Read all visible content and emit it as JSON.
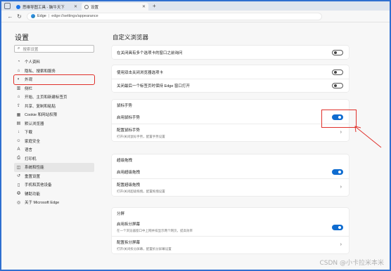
{
  "tabs": [
    {
      "title": "思维导图工具 - 脑牛天下",
      "favicon_color": "#1a73e8"
    },
    {
      "title": "设置",
      "favicon_color": "#666666",
      "active": true
    }
  ],
  "address_bar": {
    "browser": "Edge",
    "url": "edge://settings/appearance"
  },
  "sidebar": {
    "title": "设置",
    "search_placeholder": "搜索设置",
    "items": [
      {
        "label": "个人资料",
        "icon": "person-icon",
        "glyph": "◔"
      },
      {
        "label": "隐私、搜索和服务",
        "icon": "lock-icon",
        "glyph": "⌂"
      },
      {
        "label": "外观",
        "icon": "appearance-icon",
        "glyph": "◐"
      },
      {
        "label": "侧栏",
        "icon": "sidebar-icon",
        "glyph": "▥"
      },
      {
        "label": "开始、主页和新建标签页",
        "icon": "home-icon",
        "glyph": "⌂"
      },
      {
        "label": "共享、复制和粘贴",
        "icon": "share-icon",
        "glyph": "⇪"
      },
      {
        "label": "Cookie 和网站权限",
        "icon": "cookie-icon",
        "glyph": "▦"
      },
      {
        "label": "默认浏览器",
        "icon": "browser-icon",
        "glyph": "▤"
      },
      {
        "label": "下载",
        "icon": "download-icon",
        "glyph": "↓"
      },
      {
        "label": "家庭安全",
        "icon": "family-icon",
        "glyph": "☺"
      },
      {
        "label": "语言",
        "icon": "language-icon",
        "glyph": "A"
      },
      {
        "label": "打印机",
        "icon": "printer-icon",
        "glyph": "⎙"
      },
      {
        "label": "系统和性能",
        "icon": "system-icon",
        "glyph": "◫"
      },
      {
        "label": "重置设置",
        "icon": "reset-icon",
        "glyph": "↺"
      },
      {
        "label": "手机和其他设备",
        "icon": "phone-icon",
        "glyph": "▯"
      },
      {
        "label": "辅助功能",
        "icon": "accessibility-icon",
        "glyph": "✪"
      },
      {
        "label": "关于 Microsoft Edge",
        "icon": "edge-icon",
        "glyph": "◎"
      }
    ]
  },
  "main": {
    "title": "自定义浏览器",
    "cards": [
      {
        "rows": [
          {
            "label": "在关闭具有多个选项卡的窗口之前询问",
            "control": "toggle",
            "on": false
          }
        ]
      },
      {
        "rows": [
          {
            "label": "使用双击关闭浏览器选项卡",
            "control": "toggle",
            "on": false
          },
          {
            "label": "关闭最后一个标签页时保持 Edge 窗口打开",
            "control": "toggle",
            "on": false
          }
        ]
      },
      {
        "header": "鼠标手势",
        "rows": [
          {
            "label": "启用鼠标手势",
            "control": "toggle",
            "on": true
          },
          {
            "label": "配置鼠标手势",
            "desc": "打开/关闭鼠标手势，配置手势设置",
            "control": "chevron"
          }
        ]
      },
      {
        "header": "超级拖拽",
        "rows": [
          {
            "label": "启用超级拖拽",
            "control": "toggle",
            "on": true
          },
          {
            "label": "配置超级拖拽",
            "desc": "打开/关闭超级拖拽，配置拖拽设置",
            "control": "chevron"
          }
        ]
      },
      {
        "header": "分屏",
        "rows": [
          {
            "label": "启用拆分屏幕",
            "desc": "在一个浏览器窗口中上网并排显示两个网页，提高效率",
            "control": "toggle",
            "on": true
          },
          {
            "label": "配置拆分屏幕",
            "desc": "打开/关闭拆分屏幕，配置拆分屏幕设置",
            "control": "chevron"
          }
        ]
      }
    ]
  },
  "watermark": "CSDN @小卡拉米本米",
  "colors": {
    "accent": "#0f6cd0",
    "annotation": "#e0302a"
  }
}
